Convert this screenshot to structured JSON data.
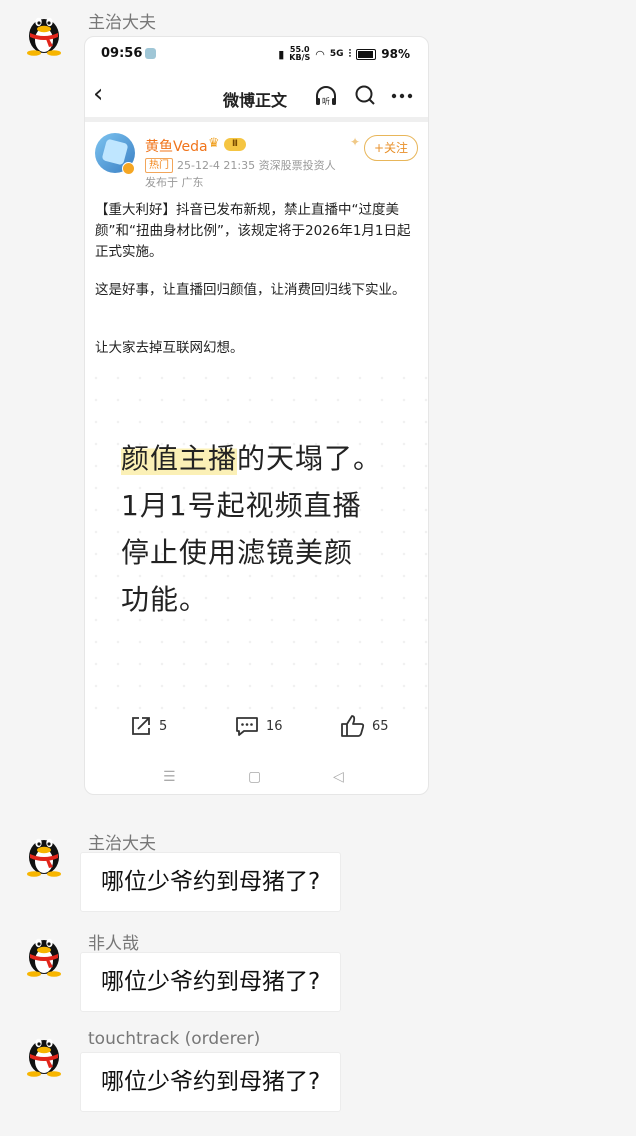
{
  "messages": [
    {
      "name": "主治大夫"
    },
    {
      "name": "主治大夫",
      "text": "哪位少爷约到母猪了?"
    },
    {
      "name": "非人哉",
      "text": "哪位少爷约到母猪了?"
    },
    {
      "name": "touchtrack (orderer)",
      "text": "哪位少爷约到母猪了?"
    }
  ],
  "phone": {
    "status": {
      "time": "09:56",
      "speed": "55.0",
      "speed_unit": "KB/S",
      "signal": "5G",
      "battery": "98%"
    },
    "nav": {
      "title": "微博正文"
    },
    "user": {
      "name": "黄鱼Veda",
      "level": "Ⅱ",
      "hot_tag": "热门",
      "meta": "25-12-4 21:35  资深股票投资人",
      "location": "发布于 广东",
      "follow_label": "+关注"
    },
    "post": {
      "para1": "【重大利好】抖音已发布新规，禁止直播中“过度美颜”和“扭曲身材比例”，该规定将于2026年1月1日起正式实施。",
      "para2": "这是好事，让直播回归颜值，让消费回归线下实业。",
      "para3": "让大家去掉互联网幻想。"
    },
    "image": {
      "line1_highlight": "颜值主播",
      "line1_rest": "的天塌了。",
      "line2": "1月1号起视频直播",
      "line3": "停止使用滤镜美颜",
      "line4": "功能。"
    },
    "actions": {
      "shares": "5",
      "comments": "16",
      "likes": "65"
    }
  }
}
